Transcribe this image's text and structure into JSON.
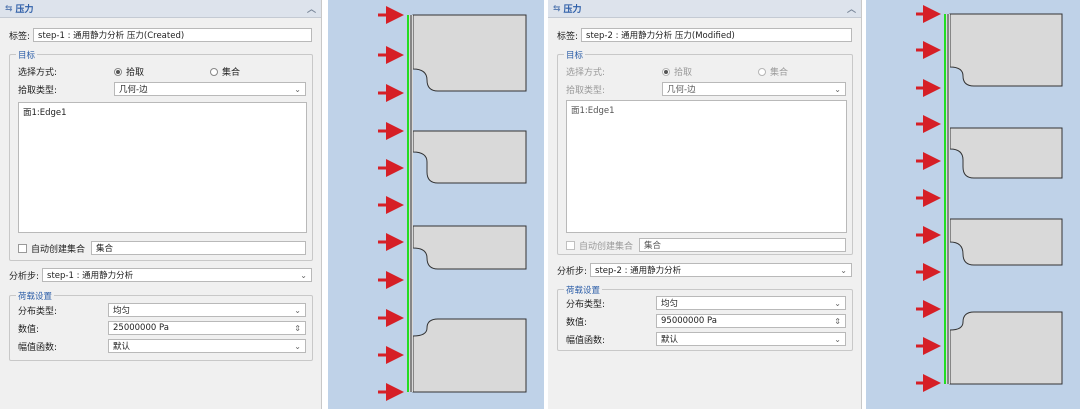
{
  "panel1": {
    "title": "压力",
    "label_caption": "标签:",
    "label_value": "step-1 : 通用静力分析 压力(Created)",
    "target": {
      "group_title": "目标",
      "select_mode_label": "选择方式:",
      "option_pick": "拾取",
      "option_set": "集合",
      "pick_type_label": "拾取类型:",
      "pick_type_value": "几何-边",
      "picked_item": "面1:Edge1",
      "auto_set_label": "自动创建集合",
      "auto_set_value": "集合"
    },
    "step_label": "分析步:",
    "step_value": "step-1 : 通用静力分析",
    "load": {
      "group_title": "荷载设置",
      "distribution_label": "分布类型:",
      "distribution_value": "均匀",
      "magnitude_label": "数值:",
      "magnitude_value": "25000000 Pa",
      "amplitude_label": "幅值函数:",
      "amplitude_value": "默认"
    }
  },
  "panel2": {
    "title": "压力",
    "label_caption": "标签:",
    "label_value": "step-2 : 通用静力分析 压力(Modified)",
    "target": {
      "group_title": "目标",
      "select_mode_label": "选择方式:",
      "option_pick": "拾取",
      "option_set": "集合",
      "pick_type_label": "拾取类型:",
      "pick_type_value": "几何-边",
      "picked_item": "面1:Edge1",
      "auto_set_label": "自动创建集合",
      "auto_set_value": "集合"
    },
    "step_label": "分析步:",
    "step_value": "step-2 : 通用静力分析",
    "load": {
      "group_title": "荷载设置",
      "distribution_label": "分布类型:",
      "distribution_value": "均匀",
      "magnitude_label": "数值:",
      "magnitude_value": "95000000 Pa",
      "amplitude_label": "幅值函数:",
      "amplitude_value": "默认"
    }
  },
  "icons": {
    "panel_header_icon": "pressure-icon",
    "collapse": "chevron-up-icon",
    "dropdown": "chevron-down-icon",
    "spinner": "spinner-icon"
  },
  "colors": {
    "viewport_bg": "#bfd2e8",
    "arrow": "#d61f26",
    "edge_highlight": "#22dd22",
    "part_fill": "#d9d9d9",
    "accent_text": "#2d5ea8"
  }
}
